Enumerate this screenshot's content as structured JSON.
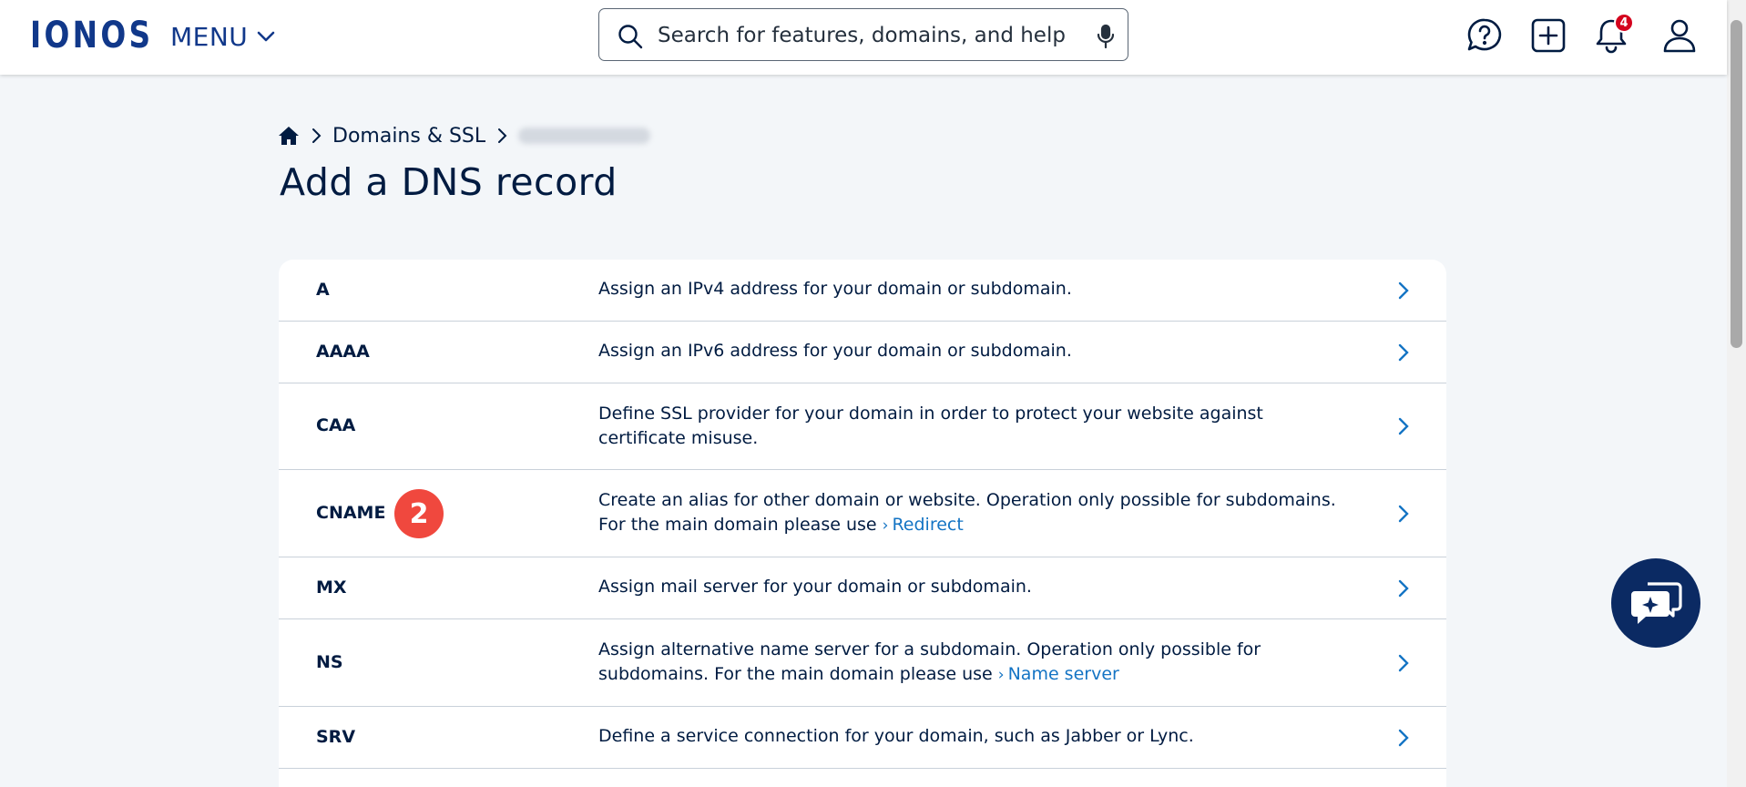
{
  "header": {
    "logo": "IONOS",
    "menu_label": "MENU",
    "search_placeholder": "Search for features, domains, and help",
    "notification_count": "4",
    "brand_color": "#11388a",
    "icons": [
      "help-chat-icon",
      "add-icon",
      "bell-icon",
      "user-icon"
    ]
  },
  "breadcrumb": {
    "home_icon": "home-icon",
    "section": "Domains & SSL"
  },
  "page": {
    "title": "Add a DNS record"
  },
  "records": [
    {
      "type": "A",
      "description": "Assign an IPv4 address for your domain or subdomain."
    },
    {
      "type": "AAAA",
      "description": "Assign an IPv6 address for your domain or subdomain."
    },
    {
      "type": "CAA",
      "description": "Define SSL provider for your domain in order to protect your website against certificate misuse."
    },
    {
      "type": "CNAME",
      "description": "Create an alias for other domain or website. Operation only possible for subdomains. For the main domain please use",
      "link": "Redirect",
      "step_badge": "2"
    },
    {
      "type": "MX",
      "description": "Assign mail server for your domain or subdomain."
    },
    {
      "type": "NS",
      "description": "Assign alternative name server for a subdomain. Operation only possible for subdomains. For the main domain please use",
      "link": "Name server"
    },
    {
      "type": "SRV",
      "description": "Define a service connection for your domain, such as Jabber or Lync."
    }
  ],
  "colors": {
    "link": "#1474c4",
    "step_badge": "#f0483e",
    "chat_fab": "#0b2a63",
    "notification_badge": "#d4021d"
  }
}
